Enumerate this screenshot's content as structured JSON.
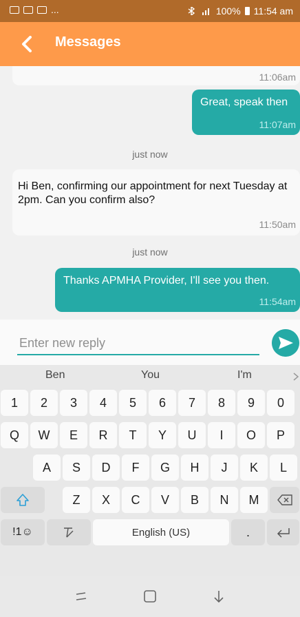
{
  "status_bar": {
    "left_dots": "...",
    "right_text": "100%",
    "time": "11:54 am"
  },
  "header": {
    "title": "Messages"
  },
  "messages": {
    "top_partial_time": "11:06am",
    "sent1": {
      "text": "Great, speak then",
      "time": "11:07am"
    },
    "divider1": "just now",
    "received": {
      "text": "Hi Ben, confirming our appointment for next Tuesday at 2pm. Can you confirm also?",
      "time": "11:50am"
    },
    "divider2": "just now",
    "sent2": {
      "text": "Thanks APMHA Provider, I'll see you then.",
      "time": "11:54am"
    }
  },
  "composer": {
    "placeholder": "Enter new reply",
    "value": ""
  },
  "keyboard": {
    "suggestions": [
      "Ben",
      "You",
      "I'm"
    ],
    "row_numbers": [
      "1",
      "2",
      "3",
      "4",
      "5",
      "6",
      "7",
      "8",
      "9",
      "0"
    ],
    "row_q": [
      "Q",
      "W",
      "E",
      "R",
      "T",
      "Y",
      "U",
      "I",
      "O",
      "P"
    ],
    "row_a": [
      "A",
      "S",
      "D",
      "F",
      "G",
      "H",
      "J",
      "K",
      "L"
    ],
    "row_z": [
      "Z",
      "X",
      "C",
      "V",
      "B",
      "N",
      "M"
    ],
    "symbols_key": "!1☺",
    "space_label": "English (US)",
    "period_key": "."
  },
  "colors": {
    "accent": "#25aaa6",
    "appbar": "#fe9a4a",
    "statusbar": "#b06a2a"
  },
  "icons": [
    "back-icon",
    "send-icon",
    "shift-icon",
    "backspace-icon",
    "handwriting-icon",
    "enter-icon",
    "recents-icon",
    "home-icon",
    "back-nav-icon"
  ]
}
